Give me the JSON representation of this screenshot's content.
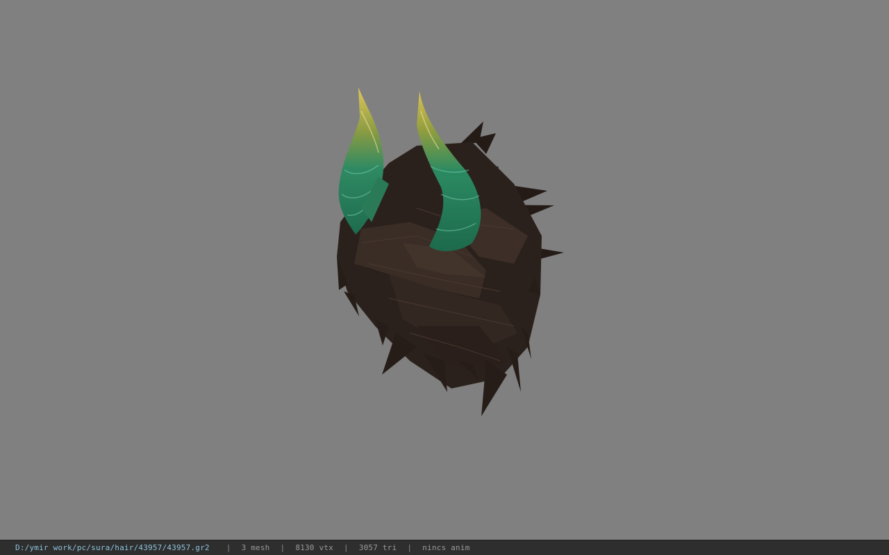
{
  "viewport": {
    "background_color": "#808080",
    "model": {
      "hair_color": "#2f2520",
      "horn_base_color": "#1f6e4f",
      "horn_tip_color": "#d9c35a"
    }
  },
  "statusbar": {
    "file_path": "D:/ymir work/pc/sura/hair/43957/43957.gr2",
    "separator": "|",
    "mesh_count": "3 mesh",
    "vertex_count": "8130 vtx",
    "triangle_count": "3057 tri",
    "anim_status": "nincs anim",
    "path_color": "#8ec3dd",
    "background_color": "#2e2e2e"
  }
}
